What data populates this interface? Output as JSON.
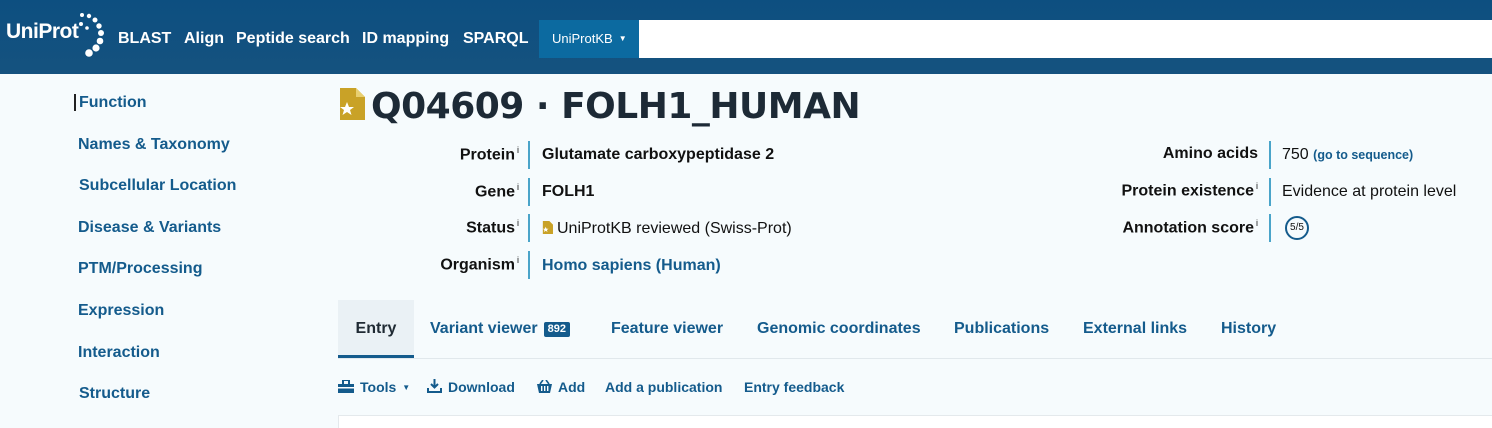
{
  "header": {
    "logo_text": "UniProt",
    "nav": [
      "BLAST",
      "Align",
      "Peptide search",
      "ID mapping",
      "SPARQL"
    ],
    "database": "UniProtKB",
    "search_placeholder": ""
  },
  "sidebar": {
    "items": [
      {
        "label": "Function"
      },
      {
        "label": "Names & Taxonomy"
      },
      {
        "label": "Subcellular Location"
      },
      {
        "label": "Disease & Variants"
      },
      {
        "label": "PTM/Processing"
      },
      {
        "label": "Expression"
      },
      {
        "label": "Interaction"
      },
      {
        "label": "Structure"
      }
    ]
  },
  "entry": {
    "title": "Q04609 · FOLH1_HUMAN",
    "info_mark": "i",
    "left_fields": [
      {
        "label": "Protein",
        "value": "Glutamate carboxypeptidase 2"
      },
      {
        "label": "Gene",
        "value": "FOLH1"
      },
      {
        "label": "Status",
        "value": "UniProtKB reviewed (Swiss-Prot)"
      },
      {
        "label": "Organism",
        "value": "Homo sapiens (Human)"
      }
    ],
    "right_fields": [
      {
        "label": "Amino acids",
        "value": "750",
        "link": "(go to sequence)"
      },
      {
        "label": "Protein existence",
        "value": "Evidence at protein level"
      },
      {
        "label": "Annotation score",
        "value": "5/5"
      }
    ]
  },
  "tabs": [
    {
      "label": "Entry"
    },
    {
      "label": "Variant viewer",
      "badge": "892"
    },
    {
      "label": "Feature viewer"
    },
    {
      "label": "Genomic coordinates"
    },
    {
      "label": "Publications"
    },
    {
      "label": "External links"
    },
    {
      "label": "History"
    }
  ],
  "toolbar": {
    "tools": "Tools",
    "download": "Download",
    "add": "Add",
    "add_publication": "Add a publication",
    "entry_feedback": "Entry feedback"
  },
  "colors": {
    "header": "#15527f",
    "accent": "#145b8c",
    "reviewed_gold": "#c9a227",
    "divider": "#4aa4c9"
  }
}
